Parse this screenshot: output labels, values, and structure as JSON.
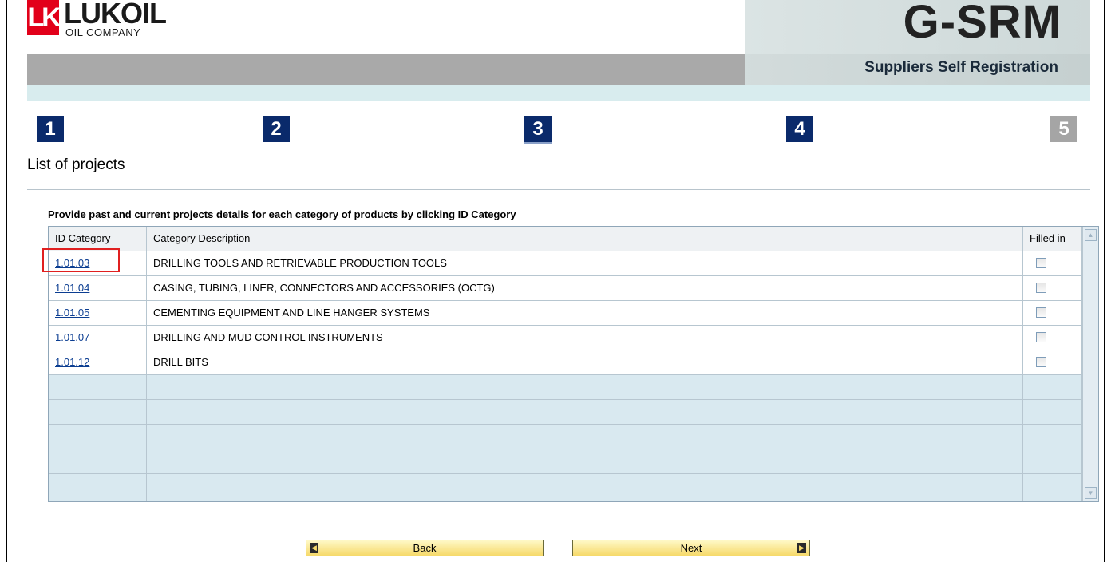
{
  "header": {
    "logo_mark": "LK",
    "logo_name": "LUKOIL",
    "logo_sub": "OIL COMPANY",
    "brand_title": "G-SRM",
    "brand_subtitle": "Suppliers Self Registration"
  },
  "steps": [
    {
      "label": "1",
      "state": "active"
    },
    {
      "label": "2",
      "state": "active"
    },
    {
      "label": "3",
      "state": "current"
    },
    {
      "label": "4",
      "state": "active"
    },
    {
      "label": "5",
      "state": "inactive"
    }
  ],
  "page": {
    "title": "List of projects",
    "instruction": "Provide past and current projects details for each category of products by clicking ID Category"
  },
  "table": {
    "columns": [
      "ID Category",
      "Category Description",
      "Filled in"
    ],
    "rows": [
      {
        "id": "1.01.03",
        "description": "DRILLING TOOLS AND RETRIEVABLE PRODUCTION TOOLS",
        "filled": false
      },
      {
        "id": "1.01.04",
        "description": "CASING, TUBING, LINER, CONNECTORS AND ACCESSORIES (OCTG)",
        "filled": false
      },
      {
        "id": "1.01.05",
        "description": "CEMENTING EQUIPMENT AND LINE HANGER SYSTEMS",
        "filled": false
      },
      {
        "id": "1.01.07",
        "description": "DRILLING AND MUD CONTROL INSTRUMENTS",
        "filled": false
      },
      {
        "id": "1.01.12",
        "description": "DRILL BITS",
        "filled": false
      }
    ],
    "empty_rows": 5
  },
  "buttons": {
    "back": "Back",
    "next": "Next"
  },
  "colors": {
    "step_active": "#0a2a6b",
    "step_inactive": "#a5a5a5",
    "highlight": "#e02020",
    "button": "#f6d96a"
  }
}
